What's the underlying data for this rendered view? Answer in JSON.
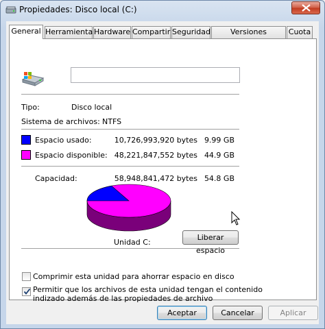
{
  "window": {
    "title": "Propiedades: Disco local (C:)"
  },
  "tabs": [
    {
      "label": "General"
    },
    {
      "label": "Herramientas"
    },
    {
      "label": "Hardware"
    },
    {
      "label": "Compartir"
    },
    {
      "label": "Seguridad"
    },
    {
      "label": "Versiones anteriores"
    },
    {
      "label": "Cuota"
    }
  ],
  "general": {
    "name_value": "",
    "type_label": "Tipo:",
    "type_value": "Disco local",
    "fs_label": "Sistema de archivos:",
    "fs_value": "NTFS",
    "used": {
      "label": "Espacio usado:",
      "bytes": "10,726,993,920 bytes",
      "size": "9.99 GB",
      "color": "#0000ff"
    },
    "free": {
      "label": "Espacio disponible:",
      "bytes": "48,221,847,552 bytes",
      "size": "44.9 GB",
      "color": "#ff00ff"
    },
    "capacity": {
      "label": "Capacidad:",
      "bytes": "58,948,841,472 bytes",
      "size": "54.8 GB"
    },
    "drive_label": "Unidad C:",
    "cleanup_button": "Liberar espacio",
    "used_fraction": 0.182,
    "compress": {
      "label": "Comprimir esta unidad para ahorrar espacio en disco",
      "checked": false
    },
    "index": {
      "label_line1": "Permitir que los archivos de esta unidad tengan el contenido",
      "label_line2": "indizado además de las propiedades de archivo",
      "checked": true
    }
  },
  "footer": {
    "ok": "Aceptar",
    "cancel": "Cancelar",
    "apply": "Aplicar"
  }
}
